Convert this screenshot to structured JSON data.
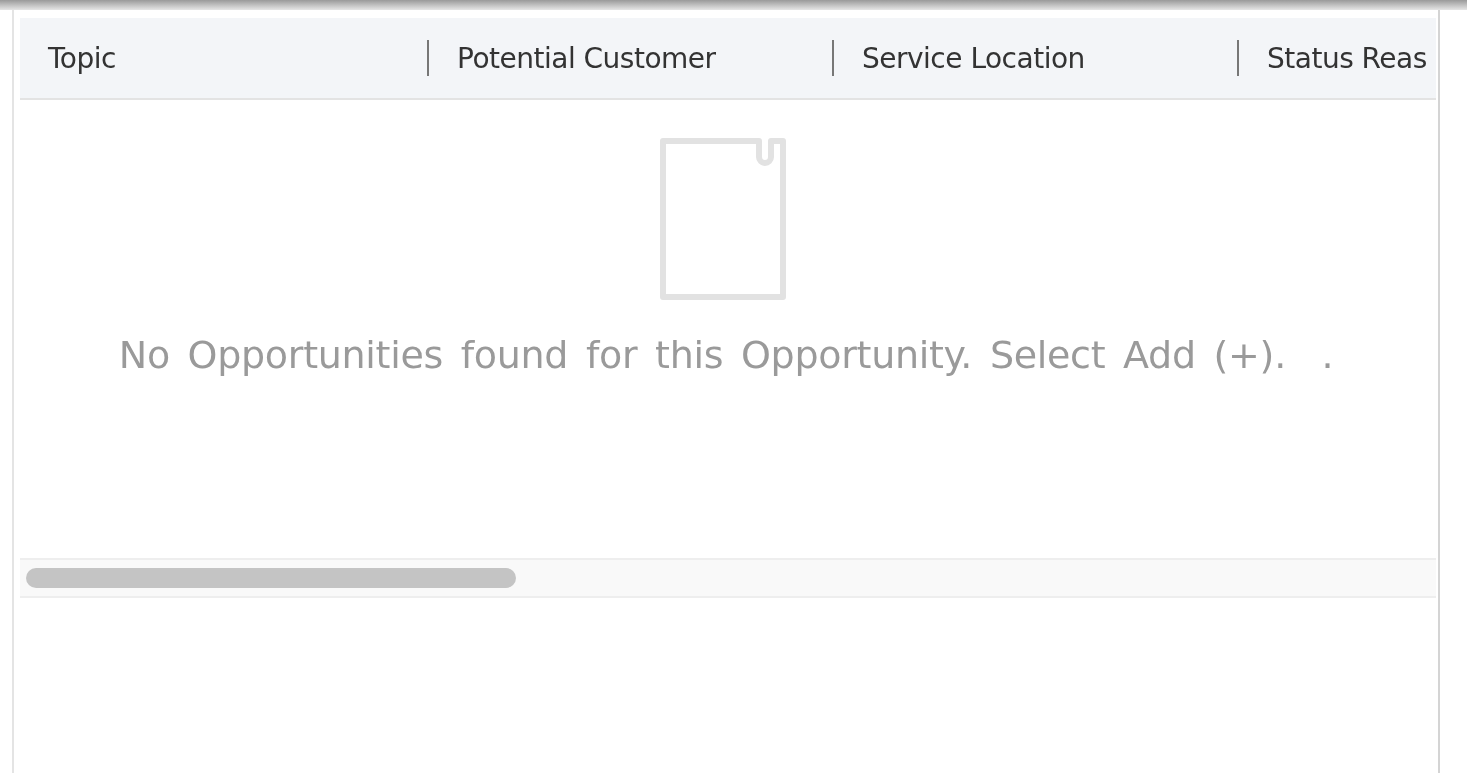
{
  "table": {
    "columns": [
      {
        "label": "Topic"
      },
      {
        "label": "Potential Customer"
      },
      {
        "label": "Service Location"
      },
      {
        "label": "Status Reas"
      }
    ],
    "empty_message": "No Opportunities found for this Opportunity. Select Add (+).  ."
  }
}
